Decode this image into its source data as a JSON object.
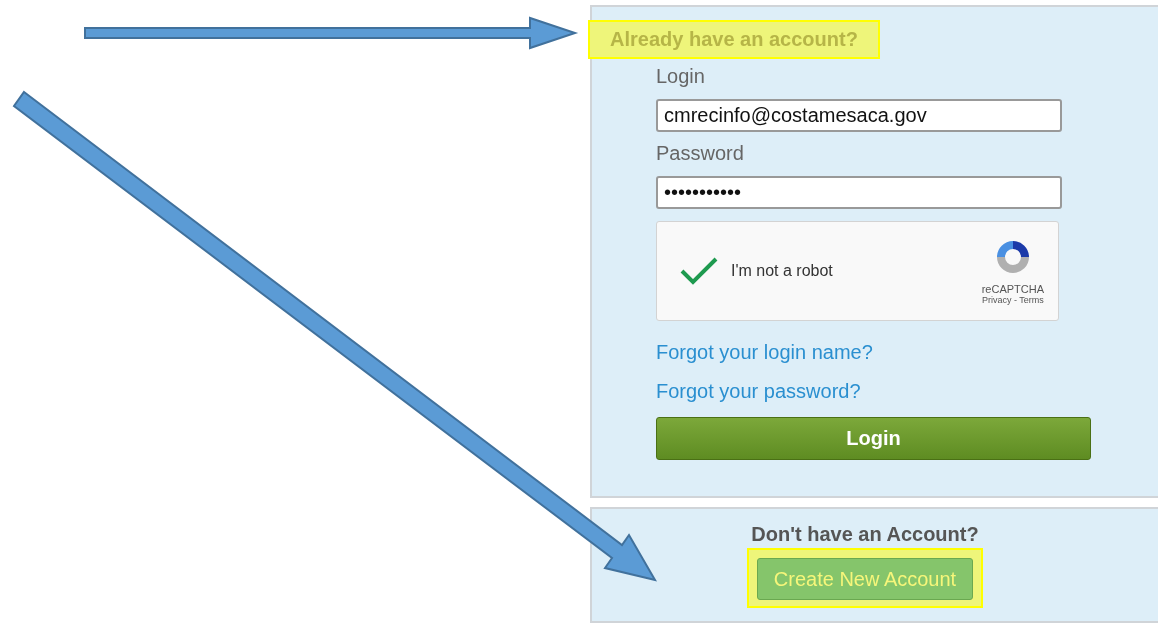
{
  "login_panel": {
    "heading": {
      "text": "Already have an account?",
      "highlighted": true
    },
    "login_label": "Login",
    "login_value": "cmrecinfo@costamesaca.gov",
    "password_label": "Password",
    "password_value": "•••••••••••",
    "captcha": {
      "checked": true,
      "label": "I'm not a robot",
      "brand": "reCAPTCHA",
      "links": "Privacy - Terms"
    },
    "links": [
      "Forgot your login name?",
      "Forgot your password?"
    ],
    "login_button": "Login"
  },
  "signup_panel": {
    "prompt": "Don't have an Account?",
    "button": {
      "text": "Create New Account",
      "highlighted": true
    }
  }
}
